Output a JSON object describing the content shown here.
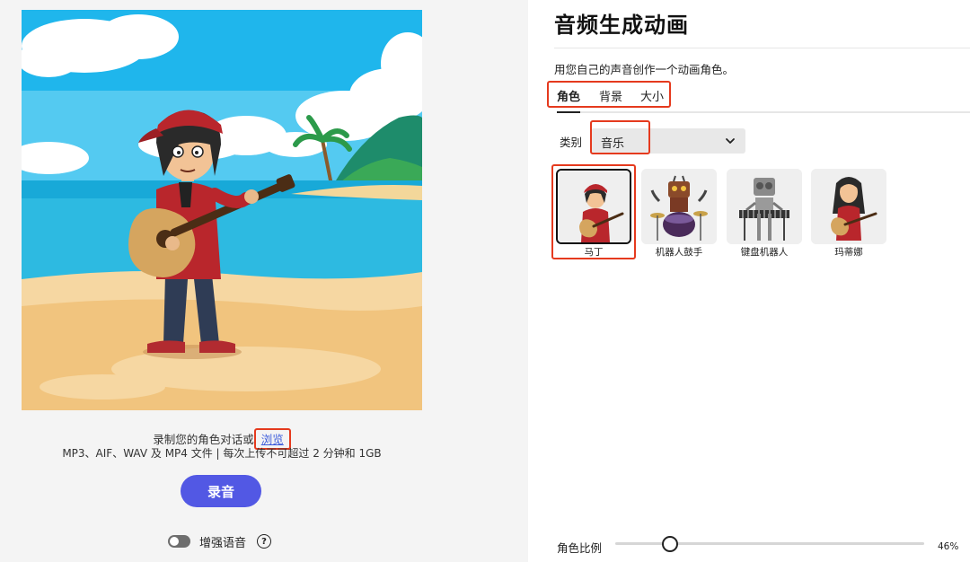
{
  "colors": {
    "accent": "#5258e4",
    "highlight": "#e53a1e",
    "link": "#3b5bdb"
  },
  "upload": {
    "prompt": "录制您的角色对话或",
    "browse_label": "浏览",
    "file_info": "MP3、AIF、WAV 及 MP4 文件 | 每次上传不可超过 2 分钟和 1GB"
  },
  "record_button": "录音",
  "enhance": {
    "label": "增强语音",
    "enabled": false,
    "help_icon": "?"
  },
  "page": {
    "title": "音频生成动画",
    "subtitle": "用您自己的声音创作一个动画角色。"
  },
  "tabs": [
    {
      "label": "角色",
      "active": true
    },
    {
      "label": "背景",
      "active": false
    },
    {
      "label": "大小",
      "active": false
    }
  ],
  "category": {
    "label": "类别",
    "value": "音乐"
  },
  "characters": [
    {
      "name": "马丁",
      "icon": "guitarist-icon",
      "selected": true
    },
    {
      "name": "机器人鼓手",
      "icon": "robot-drummer-icon",
      "selected": false
    },
    {
      "name": "键盘机器人",
      "icon": "keyboard-robot-icon",
      "selected": false
    },
    {
      "name": "玛蒂娜",
      "icon": "female-guitarist-icon",
      "selected": false
    }
  ],
  "scale": {
    "label": "角色比例",
    "value": 46,
    "value_text": "46%"
  }
}
